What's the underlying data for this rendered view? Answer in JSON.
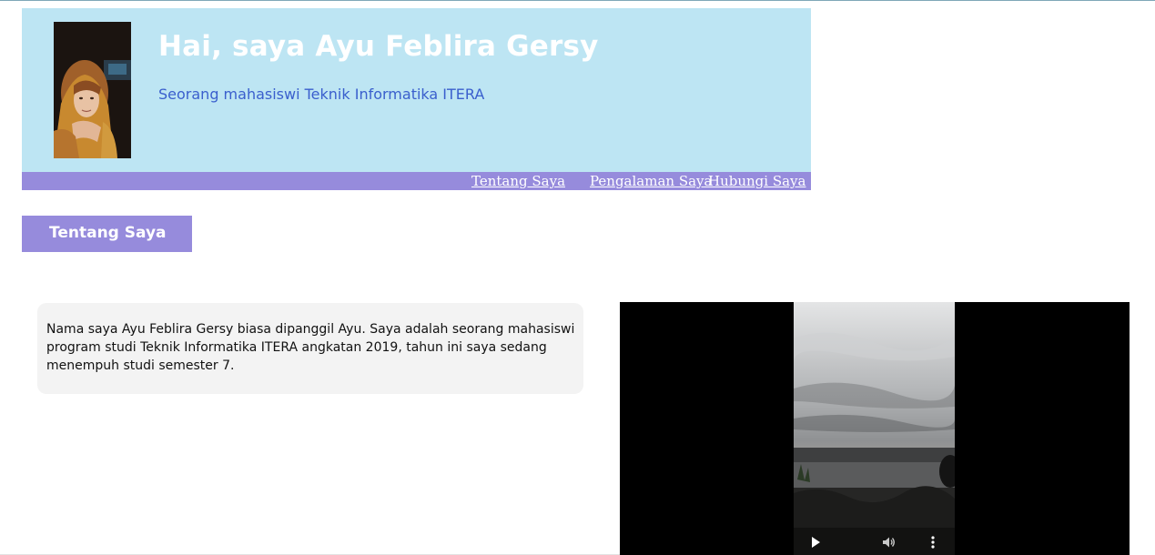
{
  "header": {
    "title": "Hai, saya Ayu Feblira Gersy",
    "subtitle": "Seorang mahasiswi Teknik Informatika ITERA",
    "avatar_icon": "profile-photo"
  },
  "nav": {
    "items": [
      {
        "label": "Tentang Saya"
      },
      {
        "label": "Pengalaman Saya"
      },
      {
        "label": "Hubungi Saya"
      }
    ]
  },
  "section": {
    "title": "Tentang Saya",
    "body": "Nama saya Ayu Feblira Gersy biasa dipanggil Ayu. Saya adalah seorang mahasiswi program studi Teknik Informatika ITERA angkatan 2019, tahun ini saya sedang menempuh studi semester 7."
  },
  "video": {
    "controls": [
      "play-icon",
      "volume-icon",
      "more-options-icon"
    ]
  },
  "colors": {
    "header_bg": "#bde5f3",
    "nav_bg": "#968bdc",
    "subtitle": "#3a5fcd",
    "card_bg": "#f3f3f3"
  }
}
